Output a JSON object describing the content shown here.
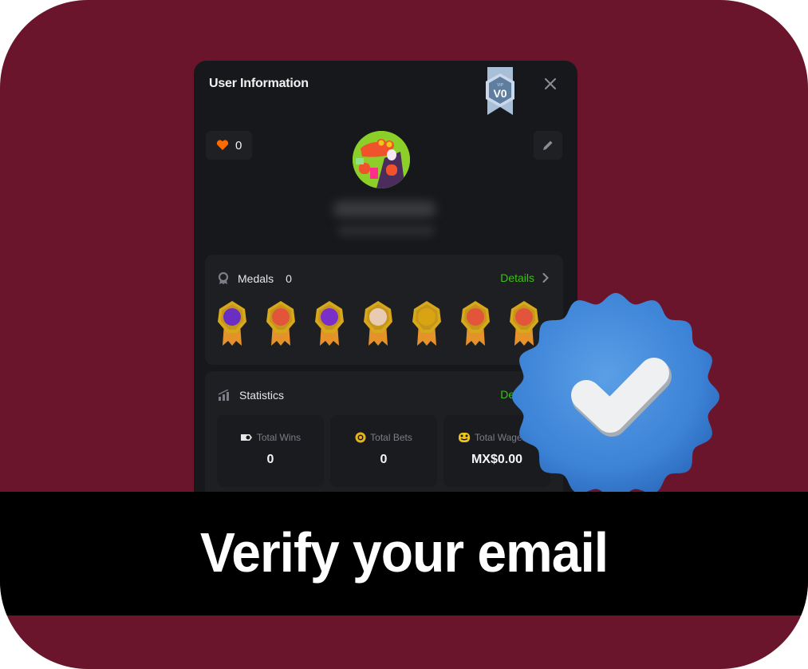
{
  "colors": {
    "background": "#6a152b",
    "card": "#17181b",
    "panel": "#1e1f22",
    "accent_green": "#3bc117",
    "verified_blue": "#3c82d6",
    "heart": "#ff6a00",
    "vip_badge": "#a9bfd8"
  },
  "modal": {
    "title": "User Information",
    "vip_badge": {
      "top_label": "VIP",
      "level": "V0",
      "icon": "vip-ribbon-icon"
    },
    "close_icon": "close-icon",
    "likes": {
      "icon": "heart-icon",
      "count": "0"
    },
    "edit_icon": "pencil-icon",
    "avatar_icon": "crocodile-avatar",
    "username": "(blurred)",
    "user_id": "(blurred)"
  },
  "medals": {
    "label": "Medals",
    "count": "0",
    "icon": "medal-icon",
    "details_label": "Details",
    "items": [
      {
        "name": "chat-medal",
        "color": "#6a2fc2"
      },
      {
        "name": "heart-medal",
        "color": "#e3553a"
      },
      {
        "name": "wallet-medal",
        "color": "#7a2fc9"
      },
      {
        "name": "thumbs-up-medal",
        "color": "#e9cbb4"
      },
      {
        "name": "gold-coin-medal",
        "color": "#d9a414"
      },
      {
        "name": "crocodile-medal",
        "color": "#e3553a"
      },
      {
        "name": "crocodile-money-medal",
        "color": "#e3553a"
      }
    ]
  },
  "statistics": {
    "label": "Statistics",
    "icon": "bar-chart-icon",
    "details_label": "Details",
    "stats": [
      {
        "label": "Total Wins",
        "value": "0",
        "icon": "ticket-icon"
      },
      {
        "label": "Total Bets",
        "value": "0",
        "icon": "chip-icon"
      },
      {
        "label": "Total Wagered",
        "value": "MX$0.00",
        "icon": "coin-stack-icon"
      }
    ]
  },
  "verified_badge": {
    "icon": "verified-check-badge-icon"
  },
  "banner": {
    "text": "Verify your email"
  }
}
